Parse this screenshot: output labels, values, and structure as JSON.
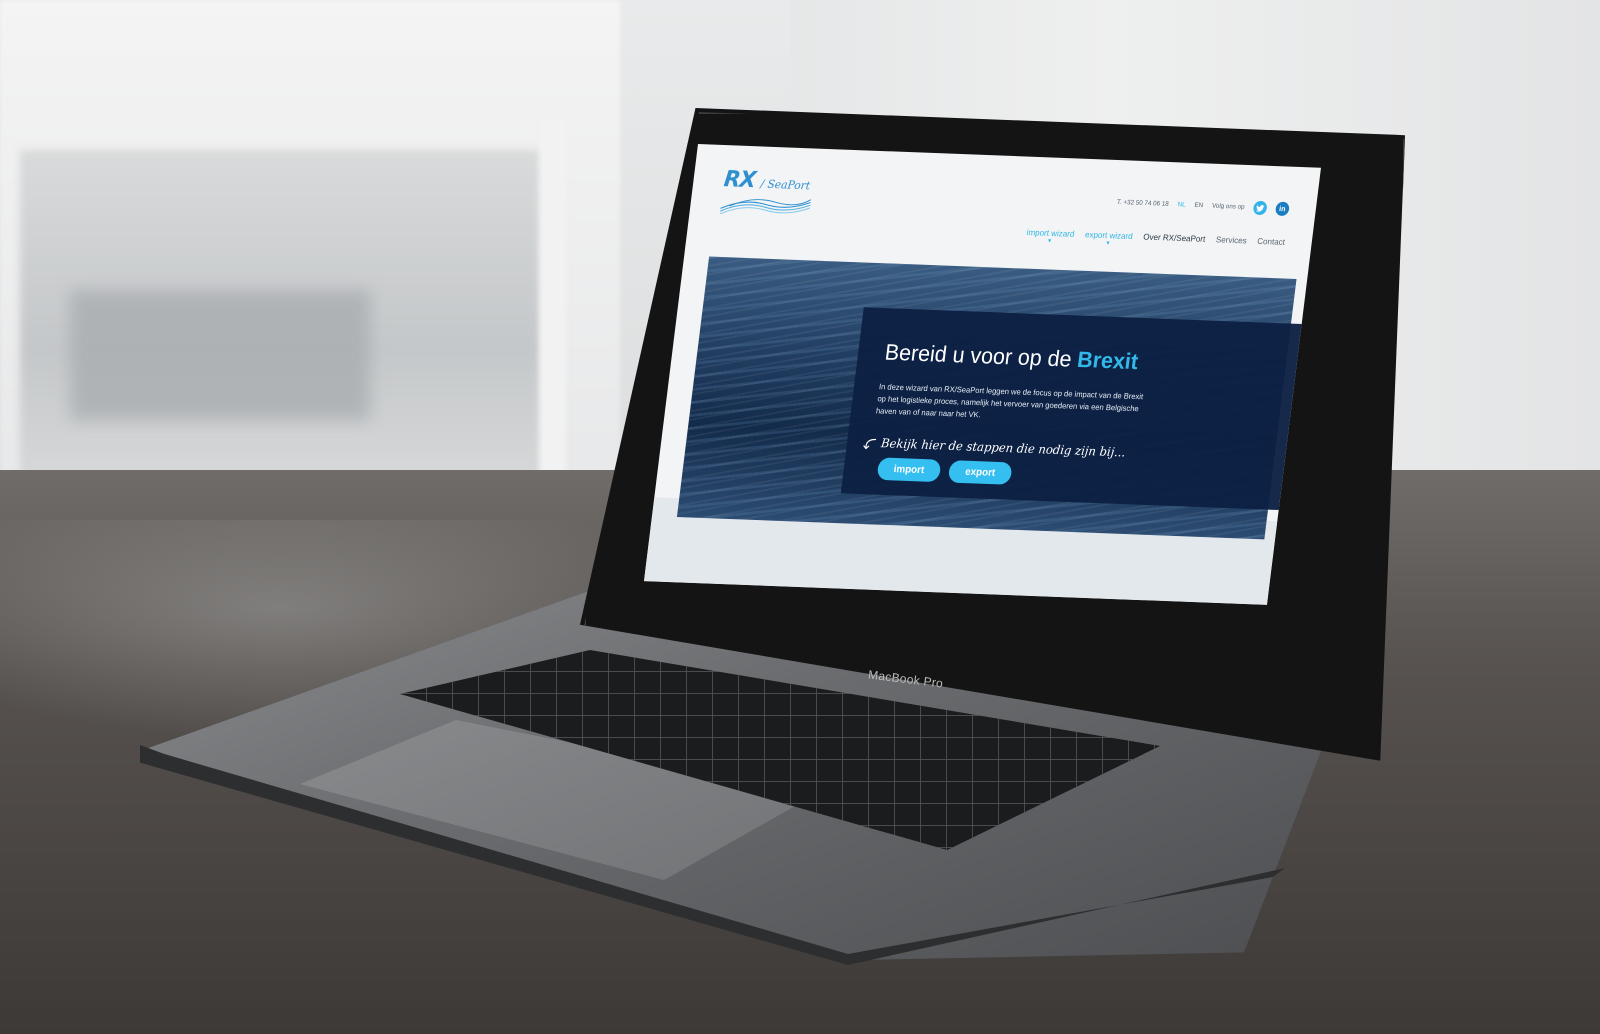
{
  "site": {
    "logo": {
      "primary": "RX",
      "secondary": "/ SeaPort"
    },
    "topbar": {
      "phone": "T. +32 50 74 06 18",
      "languages": [
        "NL",
        "EN"
      ],
      "follow_label": "Volg ons op",
      "social_icons": [
        "twitter-icon",
        "linkedin-icon"
      ],
      "linkedin_glyph": "in"
    },
    "nav": [
      {
        "label": "import wizard",
        "has_dropdown": true
      },
      {
        "label": "export wizard",
        "has_dropdown": true
      },
      {
        "label": "Over RX/SeaPort",
        "has_dropdown": false
      },
      {
        "label": "Services",
        "has_dropdown": false
      },
      {
        "label": "Contact",
        "has_dropdown": false
      }
    ],
    "hero": {
      "title_prefix": "Bereid u voor op de",
      "title_highlight": "Brexit",
      "body": "In deze wizard van RX/SeaPort leggen we de focus op de impact van de Brexit op het logistieke proces, namelijk het vervoer van goederen via een Belgische haven van of naar naar het VK.",
      "script_text": "Bekijk hier de stappen die nodig zijn bij...",
      "buttons": {
        "import": "import",
        "export": "export"
      }
    }
  },
  "device": {
    "label": "MacBook Pro"
  },
  "colors": {
    "accent": "#35bff0",
    "brand_blue": "#2f8fcf",
    "panel_navy": "#0c2044",
    "page_bg": "#f2f4f6"
  }
}
